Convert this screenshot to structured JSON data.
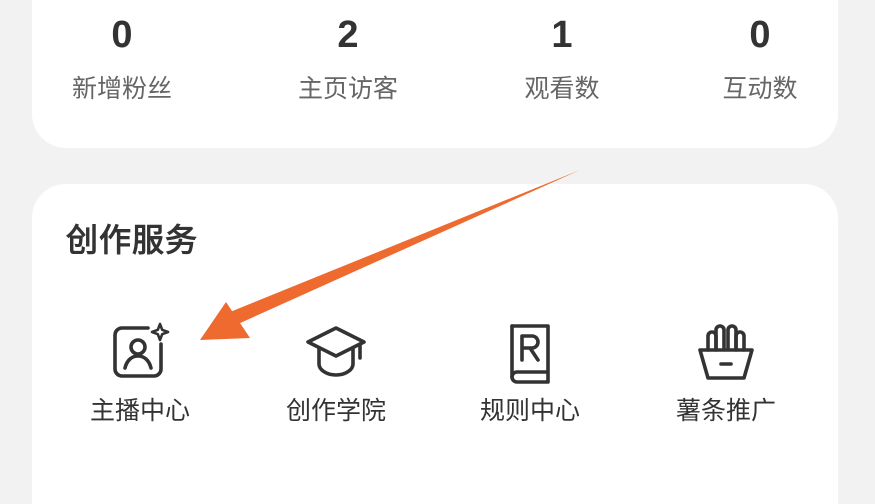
{
  "stats": [
    {
      "value": "0",
      "label": "新增粉丝"
    },
    {
      "value": "2",
      "label": "主页访客"
    },
    {
      "value": "1",
      "label": "观看数"
    },
    {
      "value": "0",
      "label": "互动数"
    }
  ],
  "services": {
    "title": "创作服务",
    "items": [
      {
        "label": "主播中心",
        "icon": "anchor-center-icon"
      },
      {
        "label": "创作学院",
        "icon": "graduation-cap-icon"
      },
      {
        "label": "规则中心",
        "icon": "rule-book-icon"
      },
      {
        "label": "薯条推广",
        "icon": "fries-icon"
      }
    ]
  },
  "annotation": {
    "type": "arrow",
    "color": "#ee6a2e",
    "points_to": "主播中心"
  },
  "colors": {
    "background": "#f2f2f2",
    "card": "#ffffff",
    "text_primary": "#333333",
    "text_secondary": "#666666",
    "icon_stroke": "#333333",
    "arrow": "#ee6a2e"
  }
}
